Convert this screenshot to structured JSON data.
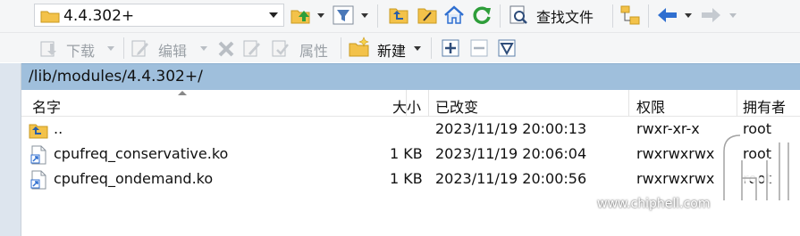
{
  "toolbar": {
    "path_combo_value": "4.4.302+",
    "find_files_label": "查找文件"
  },
  "toolbar2": {
    "download_label": "下载",
    "edit_label": "编辑",
    "properties_label": "属性",
    "new_label": "新建"
  },
  "address": {
    "path": "/lib/modules/4.4.302+/"
  },
  "columns": {
    "name": "名字",
    "size": "大小",
    "modified": "已改变",
    "permissions": "权限",
    "owner": "拥有者"
  },
  "rows": [
    {
      "name": "..",
      "size": "",
      "modified": "2023/11/19 20:00:13",
      "permissions": "rwxr-xr-x",
      "owner": "root",
      "icon": "parent-folder-icon"
    },
    {
      "name": "cpufreq_conservative.ko",
      "size": "1 KB",
      "modified": "2023/11/19 20:06:04",
      "permissions": "rwxrwxrwx",
      "owner": "root",
      "icon": "file-link-icon"
    },
    {
      "name": "cpufreq_ondemand.ko",
      "size": "1 KB",
      "modified": "2023/11/19 20:00:56",
      "permissions": "rwxrwxrwx",
      "owner": "root",
      "icon": "file-link-icon"
    }
  ],
  "watermark": {
    "url": "www.chiphell.com",
    "logo_text": "chiphell"
  },
  "colors": {
    "address_bar": "#9fbfdc",
    "toolbar_bg": "#f5f6f7",
    "folder_yellow": "#f3c24a",
    "refresh_green": "#2e9e3a",
    "nav_blue": "#2f6fd0"
  }
}
